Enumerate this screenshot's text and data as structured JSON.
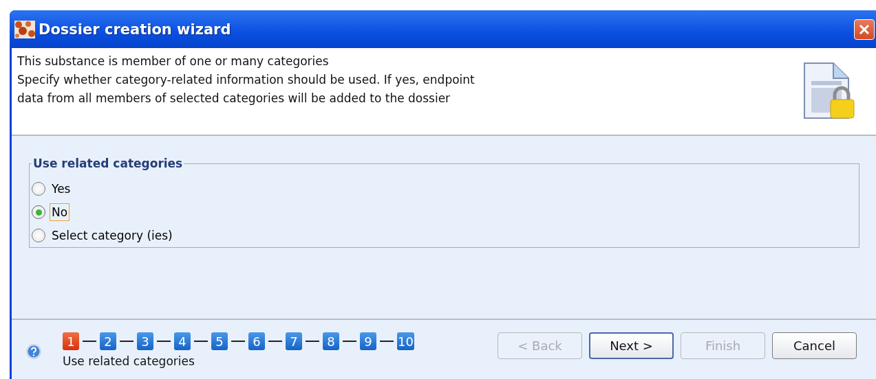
{
  "window": {
    "title": "Dossier creation wizard"
  },
  "header": {
    "lines": [
      "This substance is member of one or many categories",
      "Specify whether category-related information should be used. If yes, endpoint",
      "data from all members of selected categories will be added to the dossier"
    ]
  },
  "group": {
    "title": "Use related categories",
    "options": [
      {
        "label": "Yes",
        "selected": false,
        "focused": false
      },
      {
        "label": "No",
        "selected": true,
        "focused": true
      },
      {
        "label": "Select category (ies)",
        "selected": false,
        "focused": false
      }
    ]
  },
  "steps": [
    {
      "label": "1",
      "selected": true
    },
    {
      "label": "2",
      "selected": false
    },
    {
      "label": "3",
      "selected": false
    },
    {
      "label": "4",
      "selected": false
    },
    {
      "label": "5",
      "selected": false
    },
    {
      "label": "6",
      "selected": false
    },
    {
      "label": "7",
      "selected": false
    },
    {
      "label": "8",
      "selected": false
    },
    {
      "label": "9",
      "selected": false
    },
    {
      "label": "10",
      "selected": false
    }
  ],
  "step_caption": "Use related categories",
  "buttons": [
    {
      "label": "< Back",
      "disabled": true,
      "default": false
    },
    {
      "label": "Next >",
      "disabled": false,
      "default": true
    },
    {
      "label": "Finish",
      "disabled": true,
      "default": false
    },
    {
      "label": "Cancel",
      "disabled": false,
      "default": false
    }
  ]
}
